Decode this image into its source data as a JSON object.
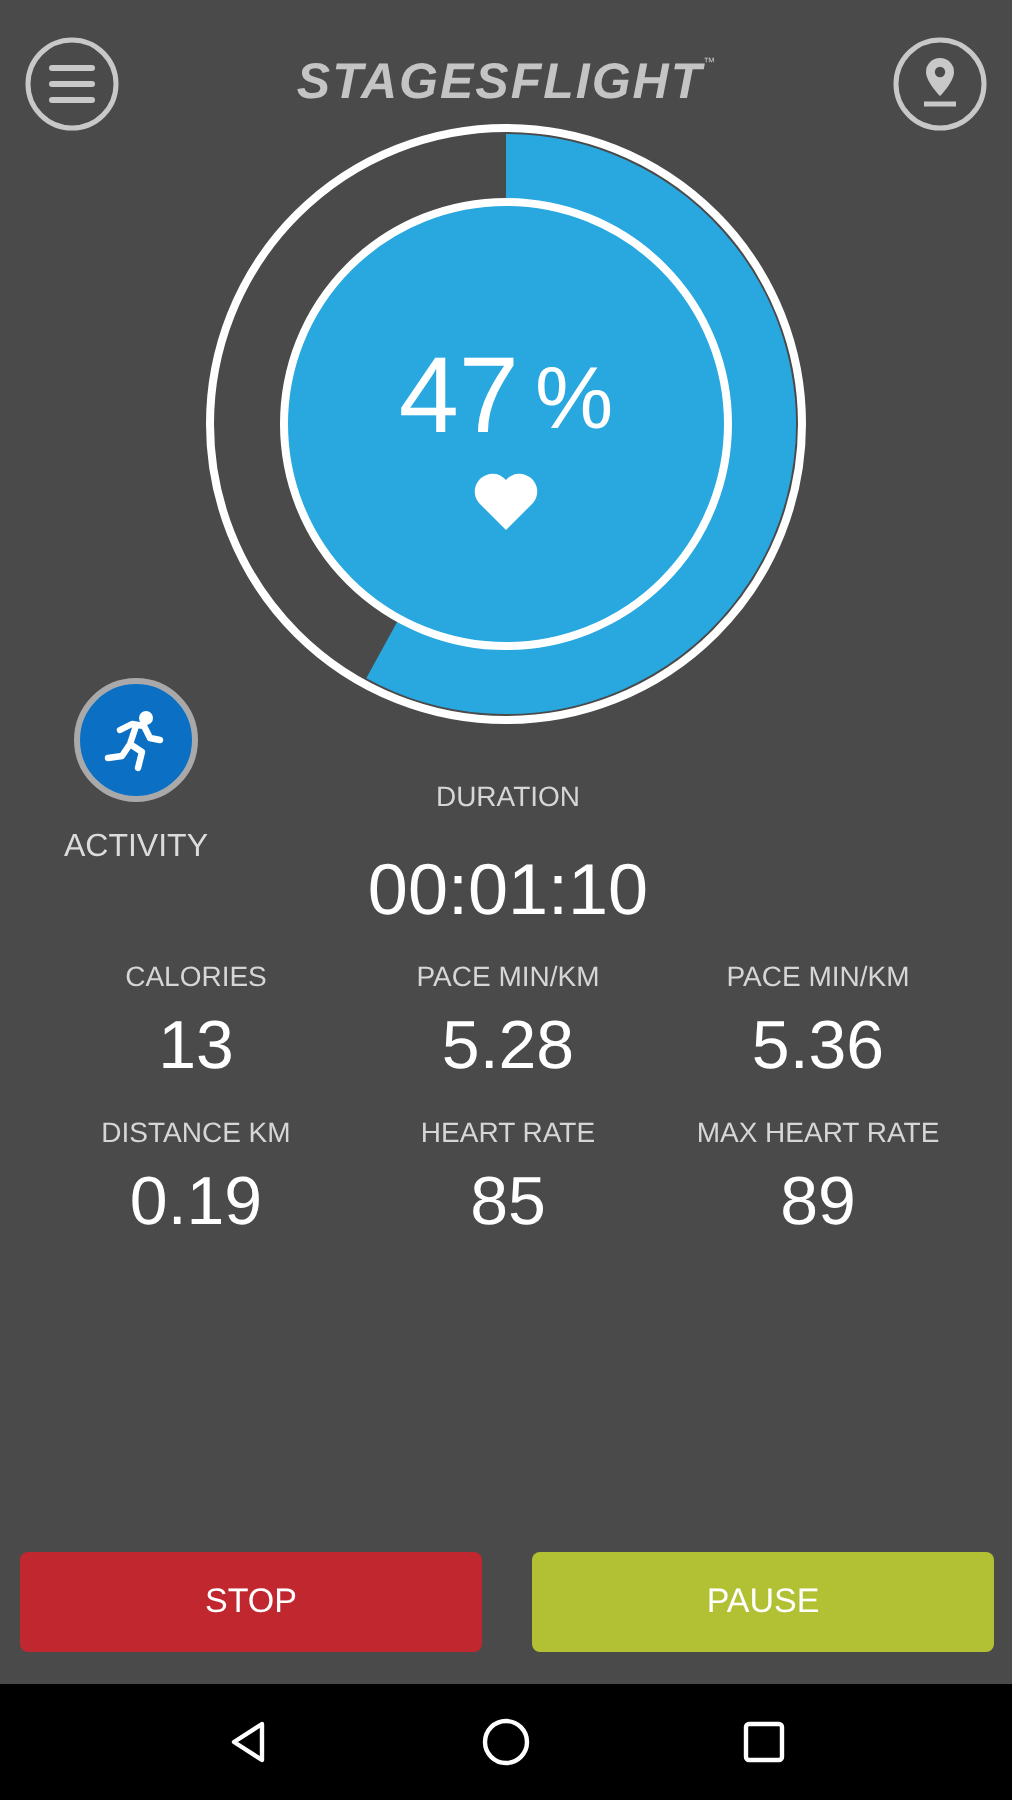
{
  "header": {
    "logo": "STAGESFLIGHT",
    "trademark": "™"
  },
  "gauge": {
    "value": "47",
    "unit": "%"
  },
  "activity": {
    "label": "ACTIVITY"
  },
  "duration": {
    "label": "DURATION",
    "value": "00:01:10"
  },
  "stats": [
    {
      "label": "CALORIES",
      "value": "13"
    },
    {
      "label": "PACE MIN/KM",
      "value": "5.28"
    },
    {
      "label": "PACE MIN/KM",
      "value": "5.36"
    },
    {
      "label": "DISTANCE KM",
      "value": "0.19"
    },
    {
      "label": "HEART RATE",
      "value": "85"
    },
    {
      "label": "MAX HEART RATE",
      "value": "89"
    }
  ],
  "buttons": [
    {
      "label": "STOP",
      "kind": "stop"
    },
    {
      "label": "PAUSE",
      "kind": "pause"
    }
  ]
}
